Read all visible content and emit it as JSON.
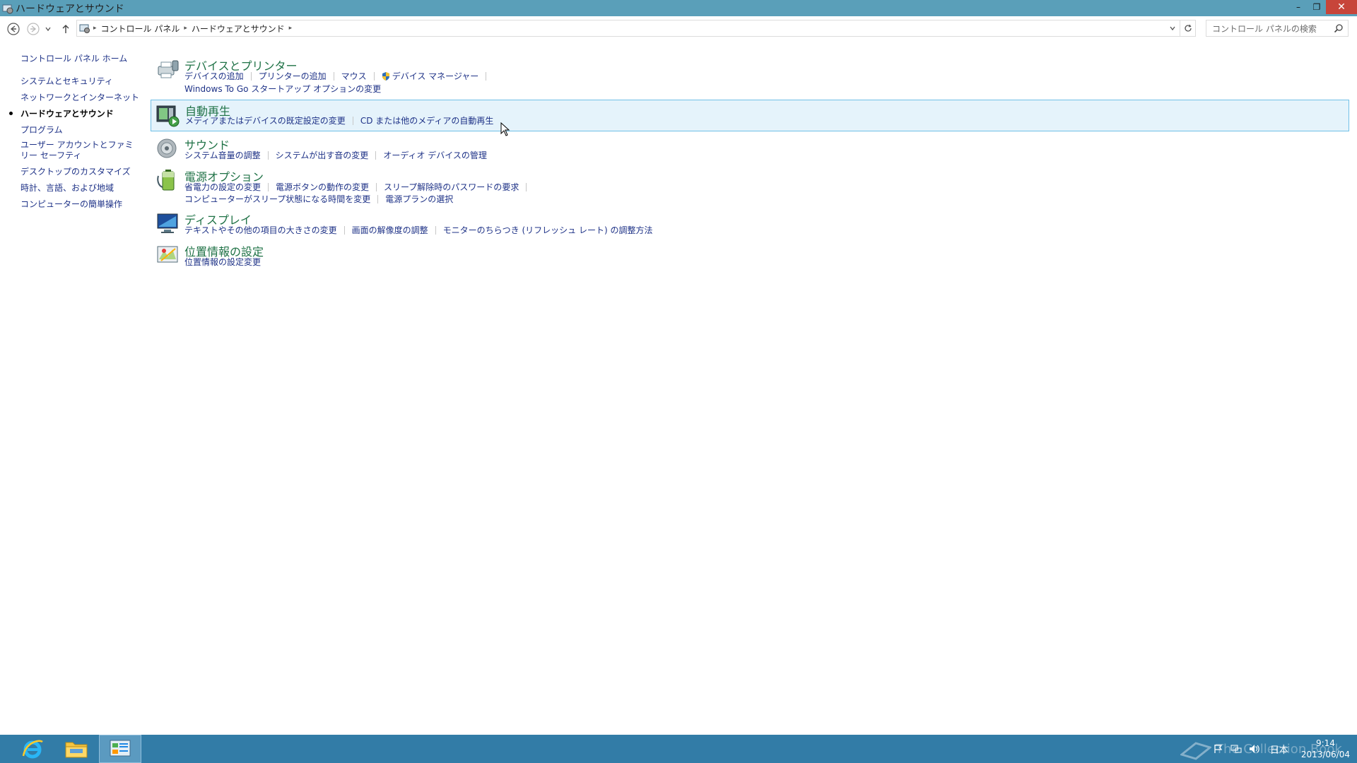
{
  "window": {
    "title": "ハードウェアとサウンド"
  },
  "window_controls": {
    "minimize": "–",
    "maximize": "❐",
    "close": "✕"
  },
  "address": {
    "crumbs": [
      "コントロール パネル",
      "ハードウェアとサウンド"
    ],
    "search_placeholder": "コントロール パネルの検索"
  },
  "sidebar": {
    "home": "コントロール パネル ホーム",
    "items": [
      {
        "label": "システムとセキュリティ"
      },
      {
        "label": "ネットワークとインターネット"
      },
      {
        "label": "ハードウェアとサウンド",
        "current": true
      },
      {
        "label": "プログラム"
      },
      {
        "label": "ユーザー アカウントとファミリー セーフティ"
      },
      {
        "label": "デスクトップのカスタマイズ"
      },
      {
        "label": "時計、言語、および地域"
      },
      {
        "label": "コンピューターの簡単操作"
      }
    ]
  },
  "categories": [
    {
      "icon": "printer-icon",
      "title": "デバイスとプリンター",
      "lines": [
        [
          "デバイスの追加",
          "プリンターの追加",
          "マウス",
          "デバイス マネージャー"
        ],
        [
          "Windows To Go スタートアップ オプションの変更"
        ]
      ]
    },
    {
      "icon": "autoplay-icon",
      "title": "自動再生",
      "highlighted": true,
      "lines": [
        [
          "メディアまたはデバイスの既定設定の変更",
          "CD または他のメディアの自動再生"
        ]
      ]
    },
    {
      "icon": "speaker-icon",
      "title": "サウンド",
      "lines": [
        [
          "システム音量の調整",
          "システムが出す音の変更",
          "オーディオ デバイスの管理"
        ]
      ]
    },
    {
      "icon": "battery-icon",
      "title": "電源オプション",
      "lines": [
        [
          "省電力の設定の変更",
          "電源ボタンの動作の変更",
          "スリープ解除時のパスワードの要求"
        ],
        [
          "コンピューターがスリープ状態になる時間を変更",
          "電源プランの選択"
        ]
      ]
    },
    {
      "icon": "monitor-icon",
      "title": "ディスプレイ",
      "lines": [
        [
          "テキストやその他の項目の大きさの変更",
          "画面の解像度の調整",
          "モニターのちらつき (リフレッシュ レート) の調整方法"
        ]
      ]
    },
    {
      "icon": "location-icon",
      "title": "位置情報の設定",
      "lines": [
        [
          "位置情報の設定変更"
        ]
      ]
    }
  ],
  "taskbar": {
    "apps": [
      {
        "name": "internet-explorer-icon"
      },
      {
        "name": "file-explorer-icon"
      },
      {
        "name": "control-panel-icon",
        "active": true
      }
    ],
    "language": "日本",
    "time": "9:14",
    "date": "2013/06/04",
    "watermark": "The Collection Book"
  },
  "colors": {
    "titlebar": "#5a9fb9",
    "taskbar": "#327ca7",
    "link": "#1e3287",
    "category_title": "#1e7145",
    "highlight_bg": "#e5f3fb",
    "highlight_border": "#70c0e7"
  }
}
